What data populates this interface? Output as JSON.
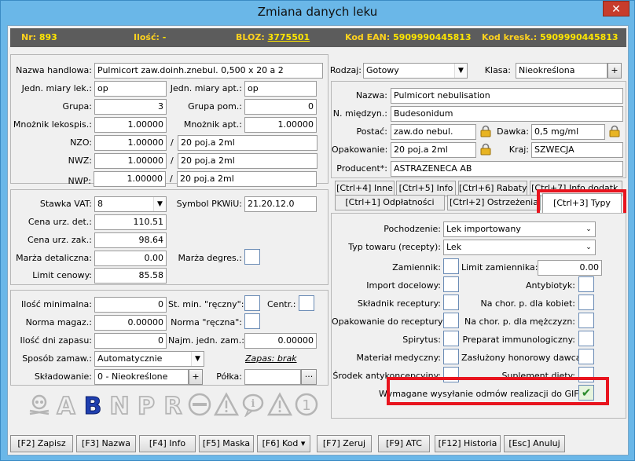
{
  "window": {
    "title": "Zmiana danych leku",
    "close": "✕"
  },
  "infobar": {
    "nr_label": "Nr:",
    "nr_value": "893",
    "ilosc_label": "Ilość:",
    "ilosc_value": "-",
    "bloz_label": "BLOZ:",
    "bloz_value": "3775501",
    "ean_label": "Kod EAN:",
    "ean_value": "5909990445813",
    "kresk_label": "Kod kresk.:",
    "kresk_value": "5909990445813"
  },
  "basic": {
    "nazwa_handlowa_label": "Nazwa handlowa:",
    "nazwa_handlowa": "Pulmicort zaw.doinh.znebul. 0,500 x 20 a 2",
    "jedn_lek_label": "Jedn. miary lek.:",
    "jedn_lek": "op",
    "jedn_apt_label": "Jedn. miary apt.:",
    "jedn_apt": "op",
    "grupa_label": "Grupa:",
    "grupa": "3",
    "grupa_pom_label": "Grupa pom.:",
    "grupa_pom": "0",
    "mnoznik_lek_label": "Mnożnik lekospis.:",
    "mnoznik_lek": "1.00000",
    "mnoznik_apt_label": "Mnożnik apt.:",
    "mnoznik_apt": "1.00000",
    "nzo_label": "NZO:",
    "nzo_value": "1.00000",
    "nzo_desc": "20 poj.a 2ml",
    "nwz_label": "NWZ:",
    "nwz_value": "1.00000",
    "nwz_desc": "20 poj.a 2ml",
    "nwp_label": "NWP:",
    "nwp_value": "1.00000",
    "nwp_desc": "20 poj.a 2ml",
    "slash": "/"
  },
  "prices": {
    "stawka_label": "Stawka VAT:",
    "stawka": "8",
    "pkwiu_label": "Symbol PKWiU:",
    "pkwiu": "21.20.12.0",
    "cena_det_label": "Cena urz. det.:",
    "cena_det": "110.51",
    "cena_zak_label": "Cena urz. zak.:",
    "cena_zak": "98.64",
    "marza_det_label": "Marża detaliczna:",
    "marza_det": "0.00",
    "marza_degres_label": "Marża degres.:",
    "limit_label": "Limit cenowy:",
    "limit": "85.58"
  },
  "stock": {
    "ilosc_min_label": "Ilość minimalna:",
    "ilosc_min": "0",
    "st_min_label": "St. min. \"ręczny\":",
    "centr_label": "Centr.:",
    "norma_mag_label": "Norma magaz.:",
    "norma_mag": "0.00000",
    "norma_reczna_label": "Norma \"ręczna\":",
    "ilosc_dni_label": "Ilość dni zapasu:",
    "ilosc_dni": "0",
    "najm_label": "Najm. jedn. zam.:",
    "najm": "0.00000",
    "sposob_label": "Sposób zamaw.:",
    "sposob": "Automatycznie",
    "zapas": "Zapas: brak",
    "skladowanie_label": "Składowanie:",
    "skladowanie": "0 - Nieokreślone",
    "polka_label": "Półka:",
    "plus": "+",
    "dots": "···"
  },
  "icons": [
    "skull-icon",
    "a-letter-icon",
    "b-letter-icon",
    "n-letter-icon",
    "p-letter-icon",
    "r-letter-icon",
    "no-entry-icon",
    "warning-triangle-icon",
    "info-bubble-icon",
    "warning-triangle-icon-2",
    "number-one-icon"
  ],
  "right": {
    "rodzaj_label": "Rodzaj:",
    "rodzaj": "Gotowy",
    "klasa_label": "Klasa:",
    "klasa": "Nieokreślona",
    "nazwa_label": "Nazwa:",
    "nazwa": "Pulmicort nebulisation",
    "n_mied_label": "N. międzyn.:",
    "n_mied": "Budesonidum",
    "postac_label": "Postać:",
    "postac": "zaw.do nebul.",
    "dawka_label": "Dawka:",
    "dawka": "0,5 mg/ml",
    "opak_label": "Opakowanie:",
    "opak": "20 poj.a 2ml",
    "kraj_label": "Kraj:",
    "kraj": "SZWECJA",
    "producent_label": "Producent*:",
    "producent": "ASTRAZENECA AB"
  },
  "tabs": {
    "inne": "[Ctrl+4] Inne",
    "info": "[Ctrl+5] Info",
    "rabaty": "[Ctrl+6] Rabaty",
    "info_dodatk": "[Ctrl+7] Info dodatk.",
    "odplatnosci": "[Ctrl+1] Odpłatności",
    "ostrzezenia": "[Ctrl+2] Ostrzeżenia",
    "typy": "[Ctrl+3] Typy"
  },
  "typy": {
    "pochodzenie_label": "Pochodzenie:",
    "pochodzenie": "Lek importowany",
    "typ_towaru_label": "Typ towaru (recepty):",
    "typ_towaru": "Lek",
    "zamiennik_label": "Zamiennik:",
    "limit_zam_label": "Limit zamiennika:",
    "limit_zam": "0.00",
    "import_label": "Import docelowy:",
    "antybiotyk_label": "Antybiotyk:",
    "skladnik_label": "Składnik receptury:",
    "kobiet_label": "Na chor. p. dla kobiet:",
    "opakowanie_rec_label": "Opakowanie do receptury:",
    "mezczyzn_label": "Na chor. p. dla mężczyzn:",
    "spirytus_label": "Spirytus:",
    "immuno_label": "Preparat immunologiczny:",
    "material_label": "Materiał medyczny:",
    "zasluzony_label": "Zasłużony honorowy dawca:",
    "srodek_label": "Środek antykoncepcyjny:",
    "suplement_label": "Suplement diety:",
    "gif_label": "Wymagane wysyłanie odmów realizacji do GIF:",
    "gif_checked": "✔"
  },
  "footer": {
    "zapisz": "[F2] Zapisz",
    "nazwa": "[F3] Nazwa",
    "info": "[F4] Info",
    "maska": "[F5] Maska",
    "kod": "[F6] Kod ▾",
    "zeruj": "[F7] Zeruj",
    "atc": "[F9] ATC",
    "historia": "[F12] Historia",
    "anuluj": "[Esc] Anuluj"
  },
  "colors": {
    "infobar_bg": "#5c5c5c",
    "infobar_text": "#ffd21e",
    "highlight": "#e8141e",
    "title_bar": "#6ab7e8"
  }
}
